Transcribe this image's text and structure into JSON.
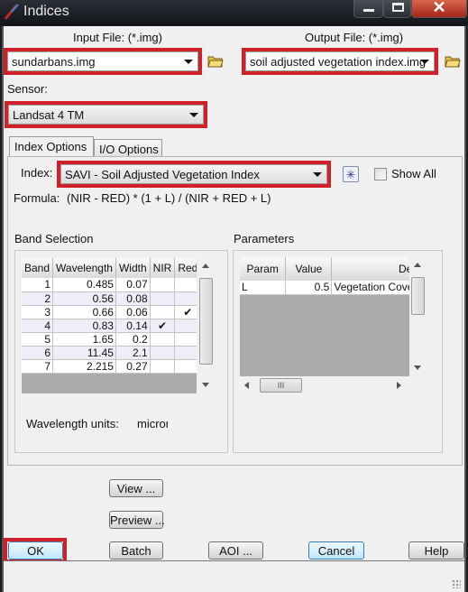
{
  "window": {
    "title": "Indices",
    "controls": {
      "minimize": "minimize-icon",
      "maximize": "maximize-icon",
      "close": "close-icon"
    }
  },
  "io": {
    "input_label": "Input File: (*.img)",
    "input_value": "sundarbans.img",
    "output_label": "Output File: (*.img)",
    "output_value": "soil adjusted vegetation index.img"
  },
  "sensor": {
    "label": "Sensor:",
    "value": "Landsat 4 TM"
  },
  "tabs": [
    {
      "label": "Index Options",
      "active": true
    },
    {
      "label": "I/O Options",
      "active": false
    }
  ],
  "index": {
    "label": "Index:",
    "value": "SAVI - Soil Adjusted Vegetation Index",
    "show_all_label": "Show All",
    "show_all_checked": false,
    "formula_label": "Formula:",
    "formula": "(NIR - RED) * (1 + L) / (NIR + RED + L)"
  },
  "band_selection": {
    "title": "Band Selection",
    "columns": [
      "Band",
      "Wavelength",
      "Width",
      "NIR",
      "Red"
    ],
    "rows": [
      {
        "band": "1",
        "wavelength": "0.485",
        "width": "0.07",
        "nir": "",
        "red": ""
      },
      {
        "band": "2",
        "wavelength": "0.56",
        "width": "0.08",
        "nir": "",
        "red": ""
      },
      {
        "band": "3",
        "wavelength": "0.66",
        "width": "0.06",
        "nir": "",
        "red": "✔"
      },
      {
        "band": "4",
        "wavelength": "0.83",
        "width": "0.14",
        "nir": "✔",
        "red": ""
      },
      {
        "band": "5",
        "wavelength": "1.65",
        "width": "0.2",
        "nir": "",
        "red": ""
      },
      {
        "band": "6",
        "wavelength": "11.45",
        "width": "2.1",
        "nir": "",
        "red": ""
      },
      {
        "band": "7",
        "wavelength": "2.215",
        "width": "0.27",
        "nir": "",
        "red": ""
      }
    ],
    "units_label": "Wavelength units:",
    "units_value": "micron"
  },
  "parameters": {
    "title": "Parameters",
    "columns": [
      "Param",
      "Value",
      "Description"
    ],
    "rows": [
      {
        "param": "L",
        "value": "0.5",
        "description": "Vegetation Cover"
      }
    ],
    "hscroll_thumb": "III"
  },
  "buttons": {
    "view": "View ...",
    "preview": "Preview ...",
    "ok": "OK",
    "batch": "Batch",
    "aoi": "AOI ...",
    "cancel": "Cancel",
    "help": "Help"
  },
  "colors": {
    "highlight": "#d0202a",
    "default_button": "#3c7fb1"
  }
}
